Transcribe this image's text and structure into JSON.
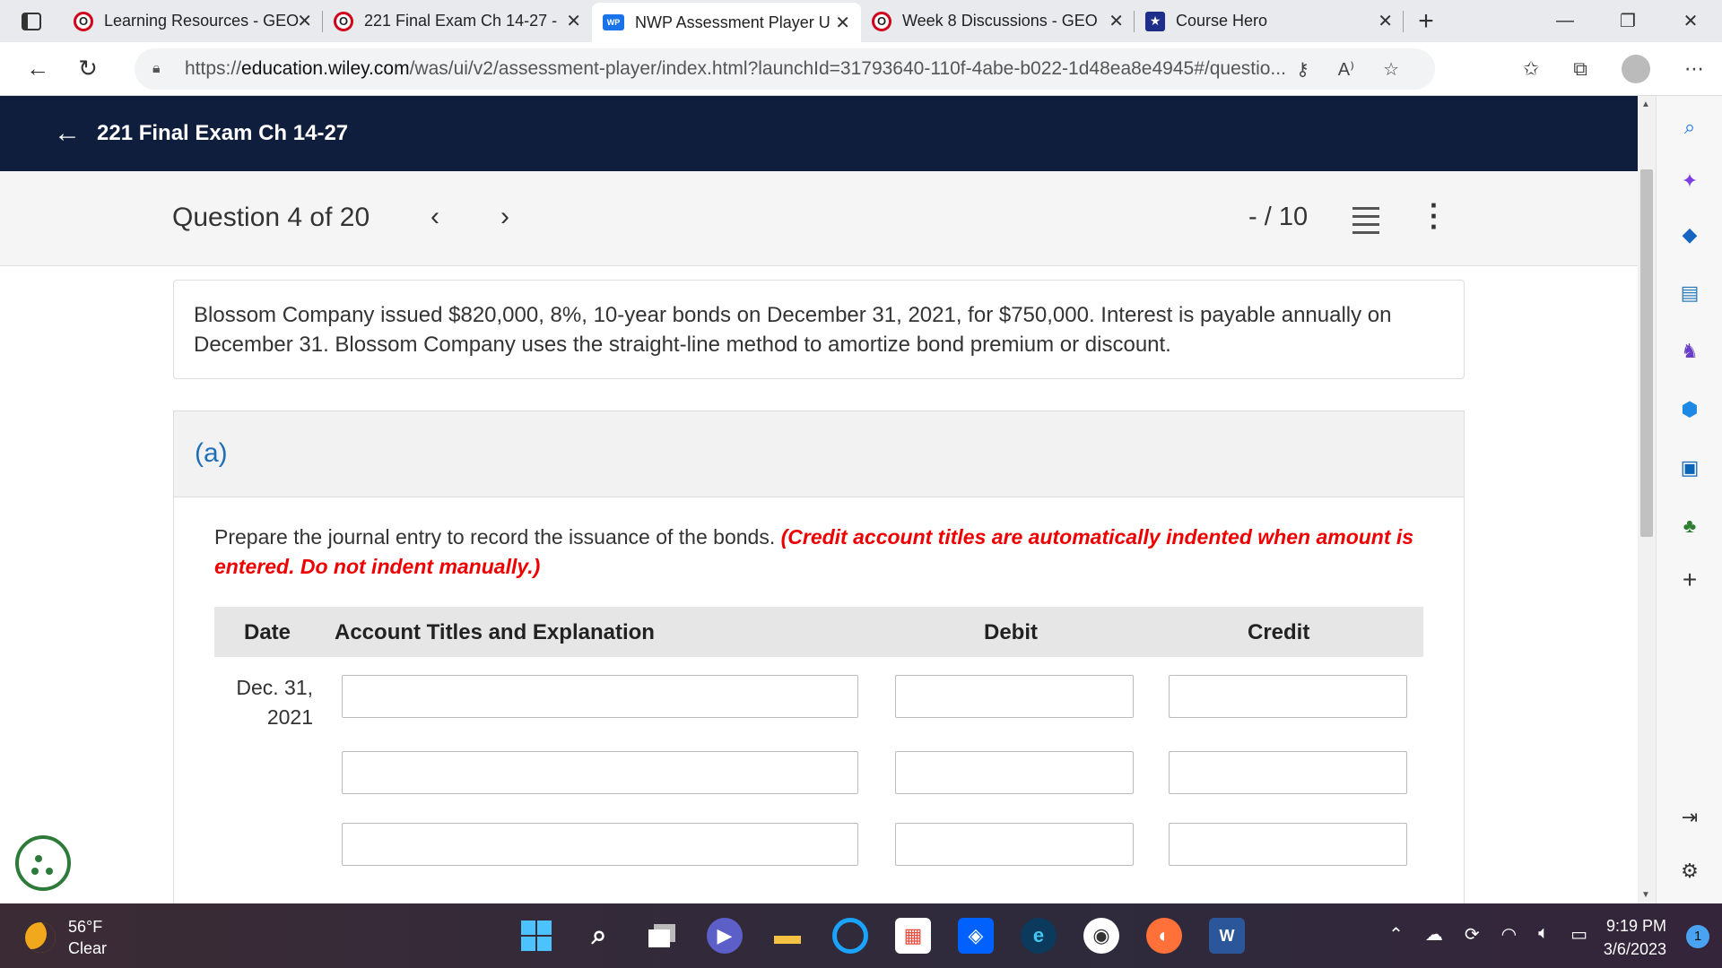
{
  "browser": {
    "tabs": [
      {
        "title": "Learning Resources - GEO",
        "favicon": "o-logo-icon"
      },
      {
        "title": "221 Final Exam Ch 14-27 -",
        "favicon": "o-logo-icon"
      },
      {
        "title": "NWP Assessment Player U",
        "favicon": "wp-icon",
        "active": true
      },
      {
        "title": "Week 8 Discussions - GEO",
        "favicon": "o-logo-icon"
      },
      {
        "title": "Course Hero",
        "favicon": "star-icon"
      }
    ],
    "wp_badge": "WP",
    "url_prefix": "https://",
    "url_domain": "education.wiley.com",
    "url_path": "/was/ui/v2/assessment-player/index.html?launchId=31793640-110f-4abe-b022-1d48ea8e4945#/questio..."
  },
  "page": {
    "header_title": "221 Final Exam Ch 14-27",
    "question_label": "Question 4 of 20",
    "score": "- / 10",
    "problem_text_line1": "Blossom Company issued $820,000, 8%, 10-year bonds on December 31, 2021, for $750,000. Interest is payable annually on",
    "problem_text_line2": "December 31. Blossom Company uses the straight-line method to amortize bond premium or discount.",
    "part_label": "(a)",
    "instruction": "Prepare the journal entry to record the issuance of the bonds.",
    "instruction_note_line1": "(Credit account titles are automatically indented when amount is",
    "instruction_note_line2": "entered. Do not indent manually.)",
    "table": {
      "headers": {
        "date": "Date",
        "account": "Account Titles and Explanation",
        "debit": "Debit",
        "credit": "Credit"
      },
      "date_line1": "Dec. 31,",
      "date_line2": "2021"
    }
  },
  "taskbar": {
    "temperature": "56°F",
    "condition": "Clear",
    "time": "9:19 PM",
    "date": "3/6/2023",
    "notifications": "1"
  }
}
